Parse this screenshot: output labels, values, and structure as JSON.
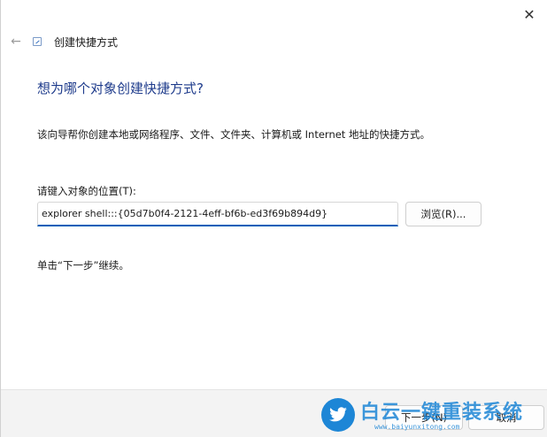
{
  "window": {
    "close_icon": "close-icon",
    "back_icon": "back-arrow-icon",
    "wizard_title": "创建快捷方式"
  },
  "main": {
    "heading": "想为哪个对象创建快捷方式?",
    "description": "该向导帮你创建本地或网络程序、文件、文件夹、计算机或 Internet 地址的快捷方式。",
    "location_label": "请键入对象的位置(T):",
    "location_value": "explorer shell:::{05d7b0f4-2121-4eff-bf6b-ed3f69b894d9}",
    "browse_label": "浏览(R)...",
    "continue_hint": "单击“下一步”继续。"
  },
  "footer": {
    "next_label": "下一步(N)",
    "cancel_label": "取消"
  },
  "watermark": {
    "text": "白云一键重装系统",
    "url": "www.baiyunxitong.com",
    "color": "#1d86d6"
  },
  "colors": {
    "heading": "#1f3c8c",
    "accent": "#005fb8",
    "footer_bg": "#f3f3f3"
  }
}
